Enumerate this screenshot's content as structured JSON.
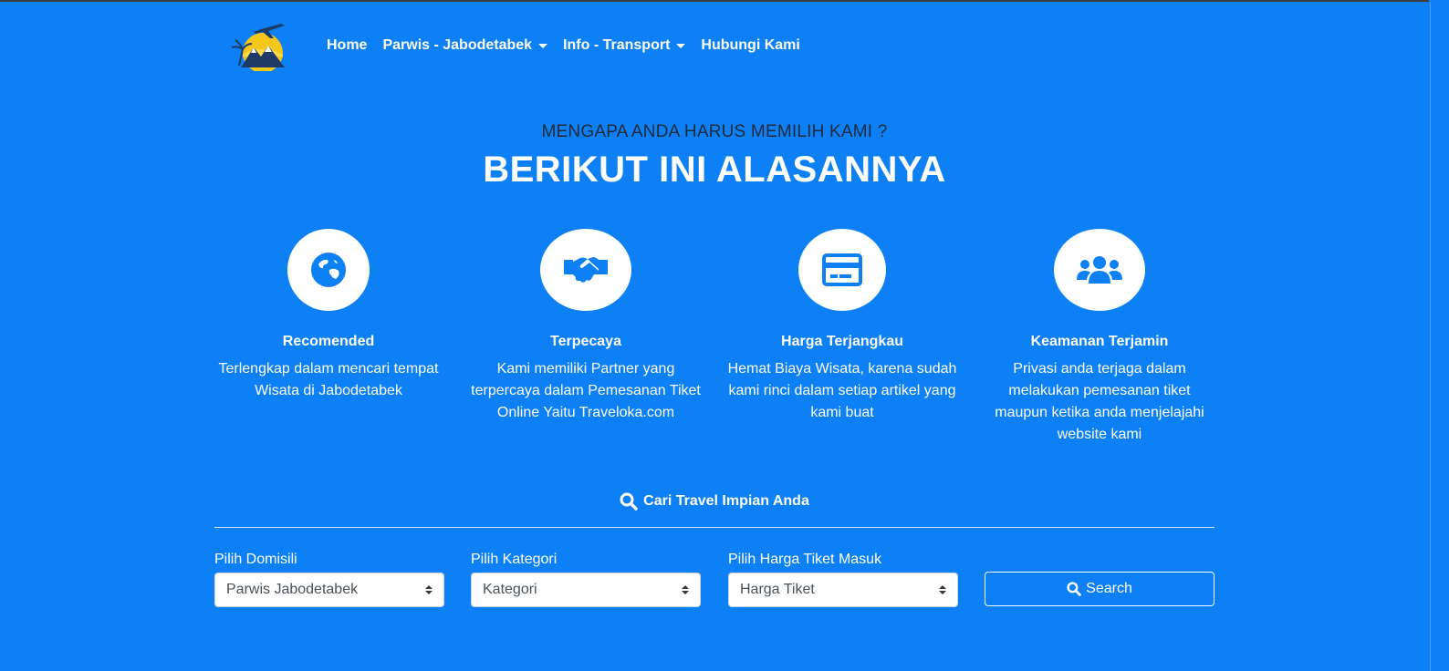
{
  "nav": {
    "items": [
      {
        "label": "Home",
        "dropdown": false
      },
      {
        "label": "Parwis - Jabodetabek",
        "dropdown": true
      },
      {
        "label": "Info - Transport",
        "dropdown": true
      },
      {
        "label": "Hubungi Kami",
        "dropdown": false
      }
    ]
  },
  "hero": {
    "subtitle": "MENGAPA ANDA HARUS MEMILIH KAMI ?",
    "title": "BERIKUT INI ALASANNYA"
  },
  "features": [
    {
      "icon": "globe-icon",
      "title": "Recomended",
      "desc": "Terlengkap dalam mencari tempat Wisata di Jabodetabek"
    },
    {
      "icon": "handshake-icon",
      "title": "Terpecaya",
      "desc": "Kami memiliki Partner yang terpercaya dalam Pemesanan Tiket Online Yaitu Traveloka.com"
    },
    {
      "icon": "credit-card-icon",
      "title": "Harga Terjangkau",
      "desc": "Hemat Biaya Wisata, karena sudah kami rinci dalam setiap artikel yang kami buat"
    },
    {
      "icon": "users-icon",
      "title": "Keamanan Terjamin",
      "desc": "Privasi anda terjaga dalam melakukan pemesanan tiket maupun ketika anda menjelajahi website kami"
    }
  ],
  "search": {
    "title": "Cari Travel Impian Anda",
    "fields": [
      {
        "label": "Pilih Domisili",
        "value": "Parwis Jabodetabek"
      },
      {
        "label": "Pilih Kategori",
        "value": "Kategori"
      },
      {
        "label": "Pilih Harga Tiket Masuk",
        "value": "Harga Tiket"
      }
    ],
    "button_label": "Search"
  },
  "colors": {
    "background": "#0d80f5",
    "icon_blue": "#0d80f5",
    "subtitle": "#1e2a3a"
  }
}
